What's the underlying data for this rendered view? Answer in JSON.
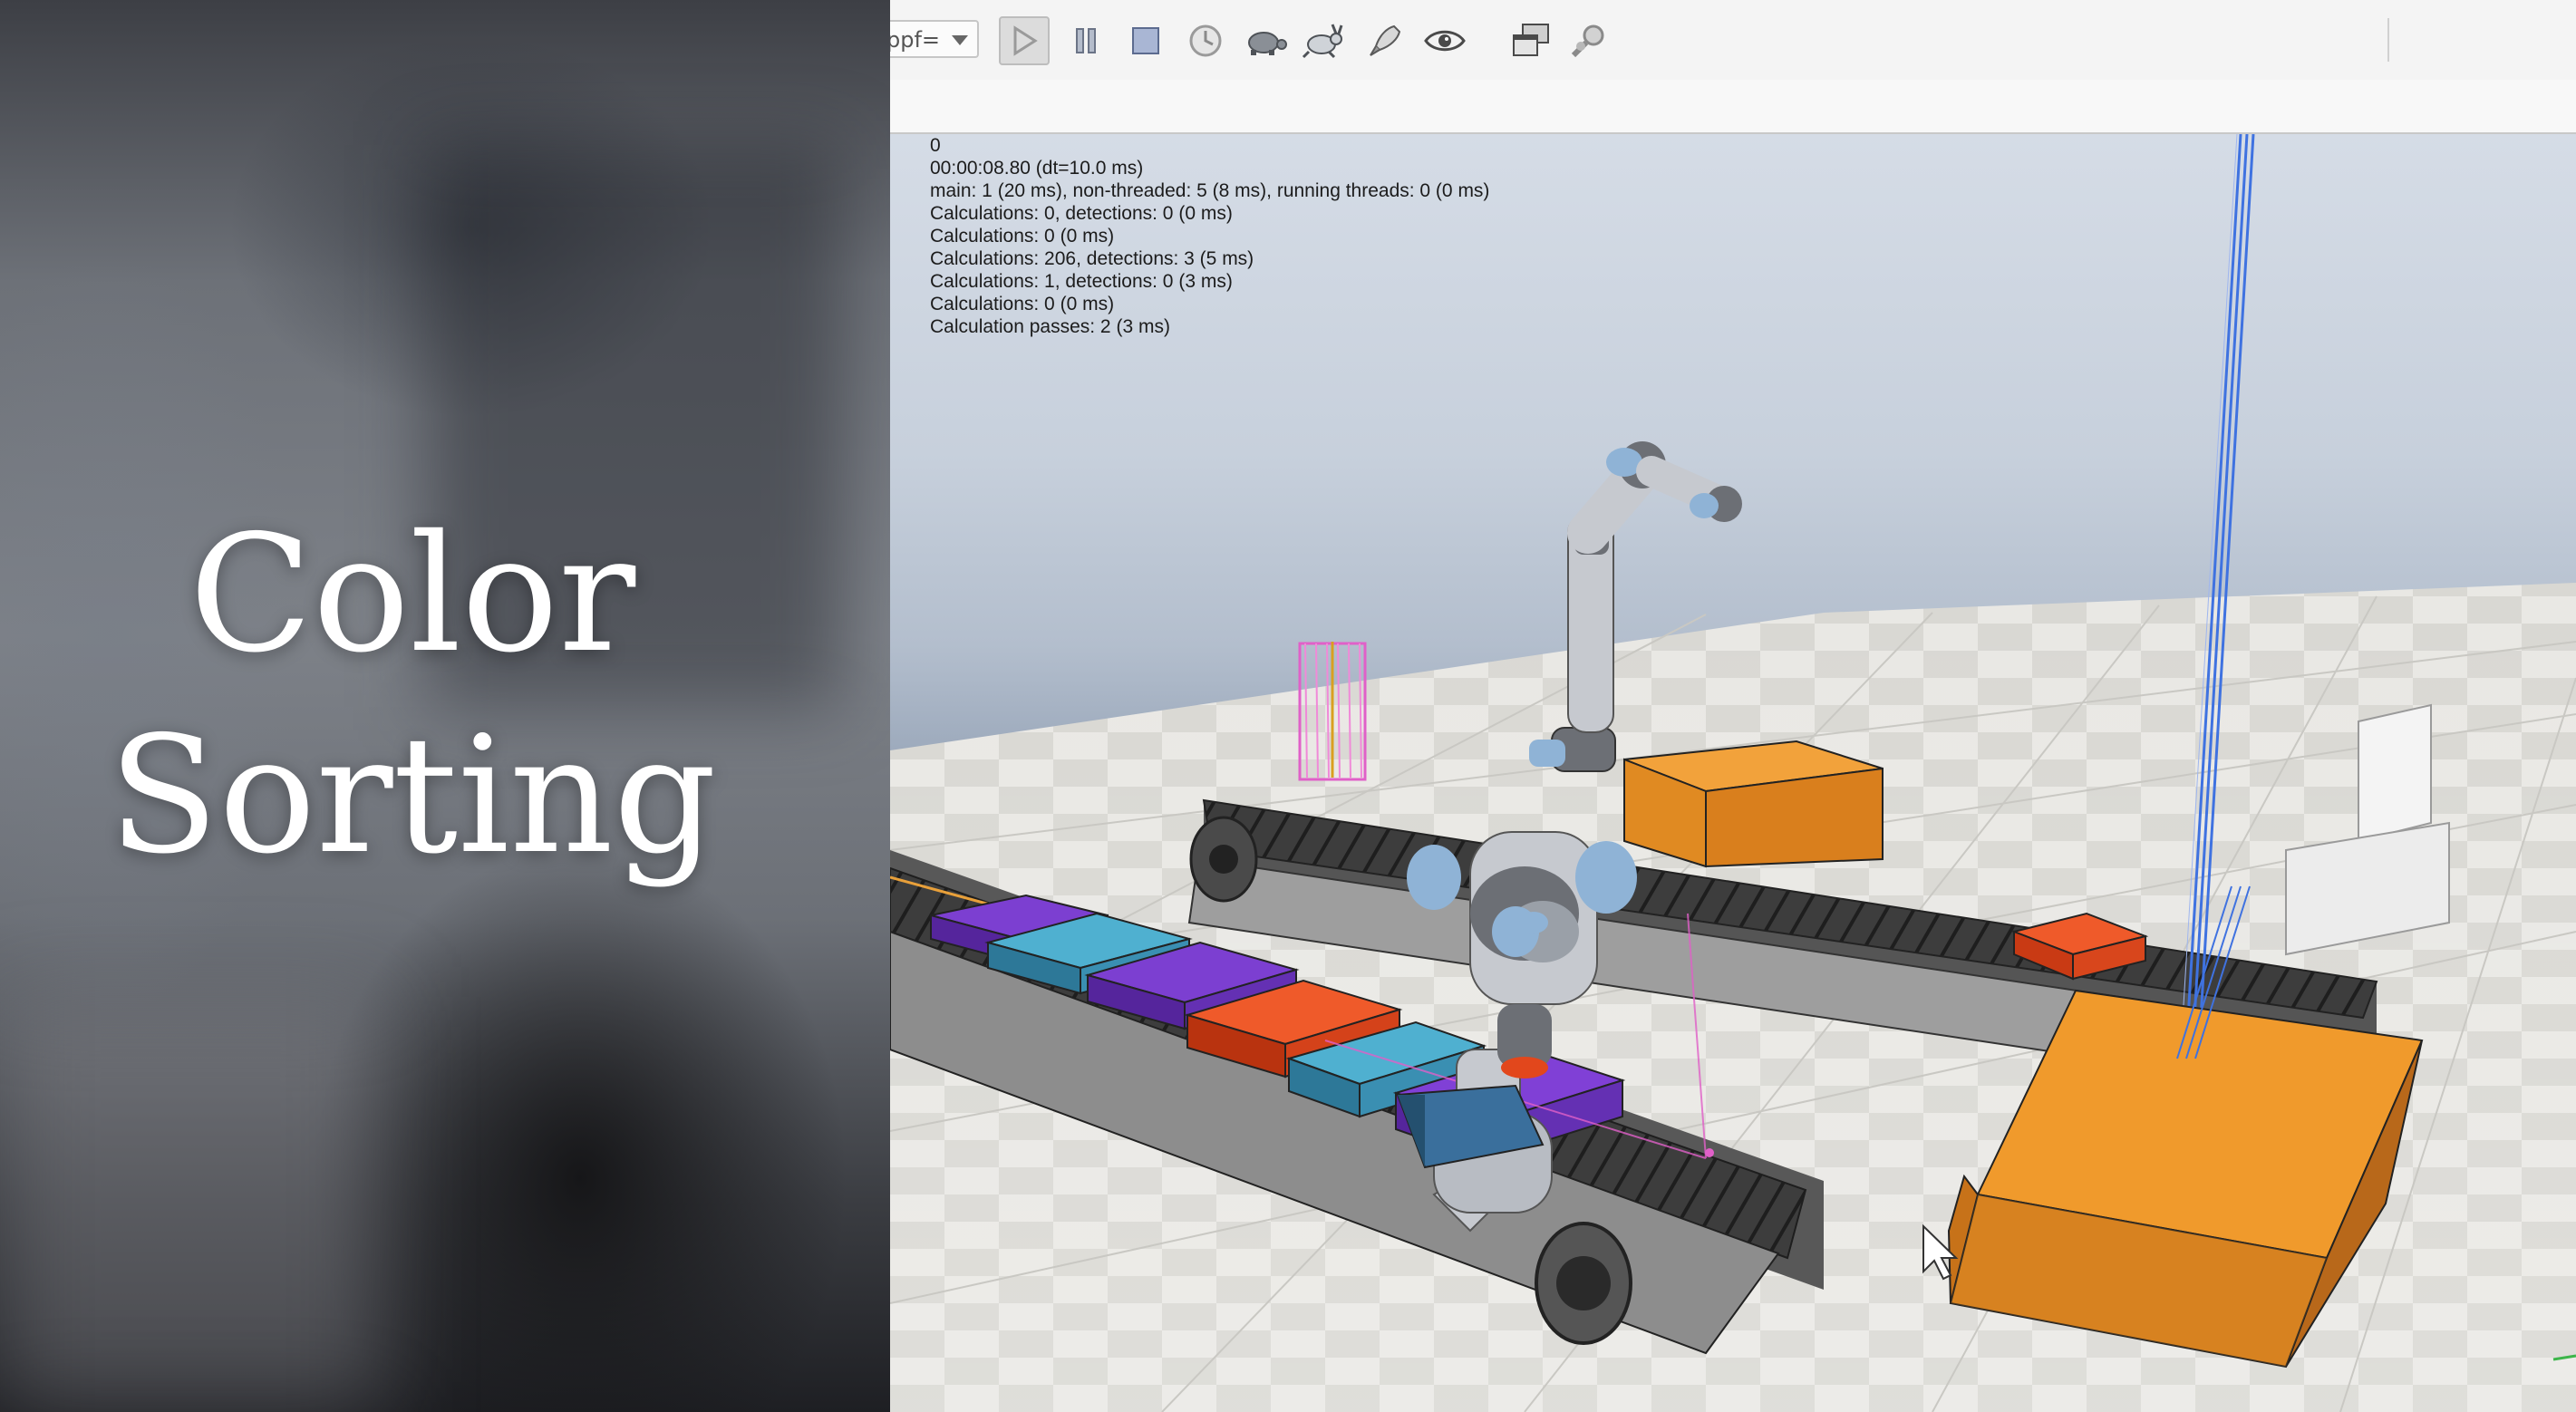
{
  "title_card": {
    "line1": "Color",
    "line2": "Sorting"
  },
  "toolbar": {
    "speed_select_value": "ppf=",
    "buttons": [
      {
        "name": "play-icon",
        "active": true
      },
      {
        "name": "pause-icon",
        "active": false
      },
      {
        "name": "stop-icon",
        "active": false
      },
      {
        "name": "realtime-clock-icon",
        "active": false
      },
      {
        "name": "slow-down-turtle-icon",
        "active": false
      },
      {
        "name": "speed-up-rabbit-icon",
        "active": false
      },
      {
        "name": "rocket-icon",
        "active": false
      },
      {
        "name": "eye-icon",
        "active": false
      },
      {
        "name": "windows-icon",
        "active": false
      },
      {
        "name": "search-settings-icon",
        "active": false
      }
    ]
  },
  "sim_info": {
    "lines": [
      "0",
      "00:00:08.80 (dt=10.0 ms)",
      "main: 1 (20 ms), non-threaded: 5 (8 ms), running threads: 0 (0 ms)",
      "Calculations: 0, detections: 0 (0 ms)",
      "Calculations: 0 (0 ms)",
      "Calculations: 206, detections: 3 (5 ms)",
      "Calculations: 1, detections: 0 (3 ms)",
      "Calculations: 0 (0 ms)",
      "Calculation passes: 2 (3 ms)"
    ]
  },
  "scene": {
    "colors": {
      "purple_block": "#6a2fb8",
      "teal_block": "#3a93b3",
      "red_block": "#e2471c",
      "orange_box": "#e7922a",
      "belt": "#3a3a3a",
      "robot_joint": "#8fb3d6",
      "vision_sensor": "#e060c8",
      "proximity_beam": "#4b7fe0"
    },
    "front_belt_blocks": [
      "purple",
      "teal",
      "purple",
      "red",
      "teal",
      "purple"
    ],
    "rear_belt_blocks": [
      "red"
    ]
  }
}
